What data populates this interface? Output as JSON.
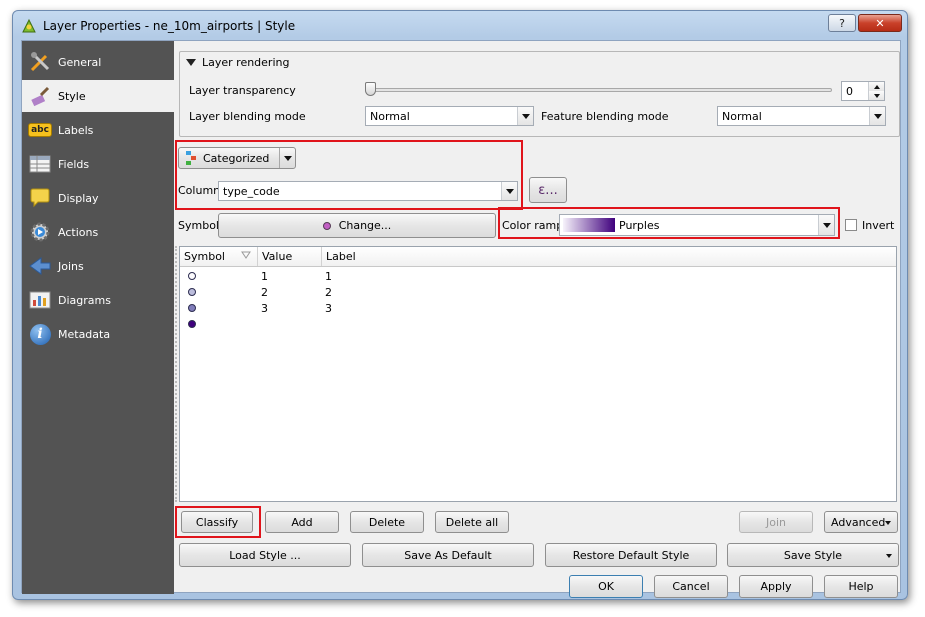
{
  "window": {
    "title": "Layer Properties - ne_10m_airports | Style"
  },
  "titlebar": {
    "help_label": "?",
    "close_label": "✕"
  },
  "sidebar": {
    "items": [
      {
        "label": "General",
        "icon": "tools-icon"
      },
      {
        "label": "Style",
        "icon": "brush-icon"
      },
      {
        "label": "Labels",
        "icon": "abc-label-icon"
      },
      {
        "label": "Fields",
        "icon": "table-icon"
      },
      {
        "label": "Display",
        "icon": "speech-bubble-icon"
      },
      {
        "label": "Actions",
        "icon": "gear-play-icon"
      },
      {
        "label": "Joins",
        "icon": "join-arrow-icon"
      },
      {
        "label": "Diagrams",
        "icon": "chart-icon"
      },
      {
        "label": "Metadata",
        "icon": "info-icon"
      }
    ],
    "active_index": 1
  },
  "layer_rendering": {
    "group_title": "Layer rendering",
    "transparency_label": "Layer transparency",
    "transparency_value": "0",
    "transparency_fraction": 0,
    "blending_label": "Layer blending mode",
    "blending_value": "Normal",
    "feature_blending_label": "Feature blending mode",
    "feature_blending_value": "Normal"
  },
  "renderer": {
    "type_value": "Categorized",
    "column_label": "Column",
    "column_value": "type_code",
    "expression_label": "ε...",
    "symbol_label": "Symbol",
    "change_label": "Change...",
    "symbol_color": "#c25fc4",
    "color_ramp_label": "Color ramp",
    "color_ramp_value": "Purples",
    "color_ramp_start": "#f7f3fb",
    "color_ramp_end": "#3f007d",
    "invert_label": "Invert",
    "invert_checked": false
  },
  "table": {
    "headers": [
      "Symbol",
      "Value",
      "Label"
    ],
    "rows": [
      {
        "color": "#fcfbfd",
        "value": "1",
        "label": "1"
      },
      {
        "color": "#bcbddc",
        "value": "2",
        "label": "2"
      },
      {
        "color": "#807dba",
        "value": "3",
        "label": "3"
      },
      {
        "color": "#3f007d",
        "value": "",
        "label": ""
      }
    ]
  },
  "actions": {
    "classify": "Classify",
    "add": "Add",
    "delete": "Delete",
    "delete_all": "Delete all",
    "join": "Join",
    "advanced": "Advanced"
  },
  "style_buttons": {
    "load": "Load Style ...",
    "save_default": "Save As Default",
    "restore_default": "Restore Default Style",
    "save_style": "Save Style"
  },
  "dialog_buttons": {
    "ok": "OK",
    "cancel": "Cancel",
    "apply": "Apply",
    "help": "Help"
  },
  "colors": {
    "highlight": "#e0141b",
    "sidebar_bg": "#535353"
  }
}
